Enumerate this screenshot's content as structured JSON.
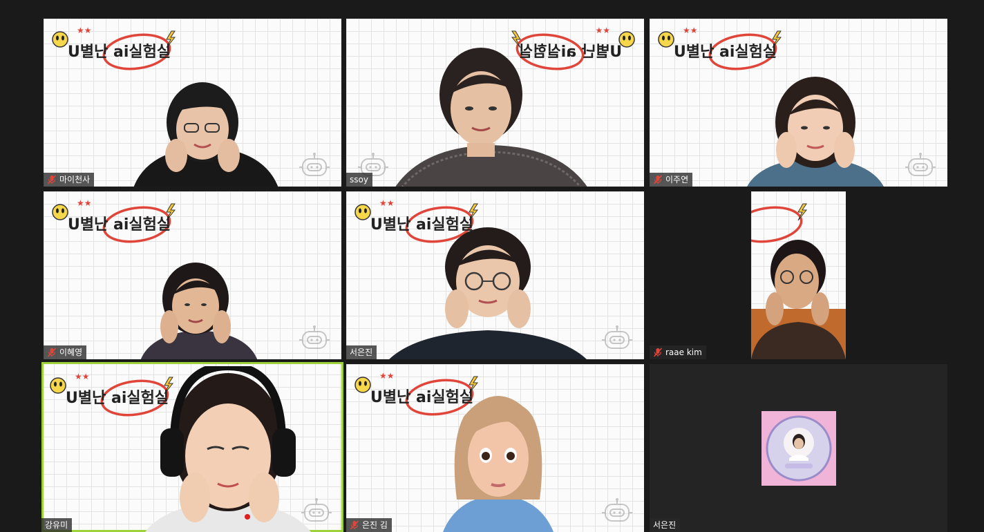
{
  "meeting": {
    "banner_text": "U별난 ai실험실",
    "participants": [
      {
        "name": "마이천사",
        "muted": true,
        "video": true
      },
      {
        "name": "ssoy",
        "muted": false,
        "video": true
      },
      {
        "name": "이주연",
        "muted": true,
        "video": true
      },
      {
        "name": "이혜영",
        "muted": true,
        "video": true
      },
      {
        "name": "서은진",
        "muted": false,
        "video": true
      },
      {
        "name": "raae kim",
        "muted": true,
        "video": true
      },
      {
        "name": "강유미",
        "muted": false,
        "video": true,
        "active_speaker": true
      },
      {
        "name": "은진 김",
        "muted": true,
        "video": true,
        "avatar": true
      },
      {
        "name": "서은진",
        "muted": false,
        "video": false
      }
    ]
  },
  "colors": {
    "background": "#1a1a1a",
    "tile_off": "#242424",
    "active_border": "#9ed23a",
    "mute_icon": "#e0453a",
    "banner_circle": "#e0453a"
  }
}
